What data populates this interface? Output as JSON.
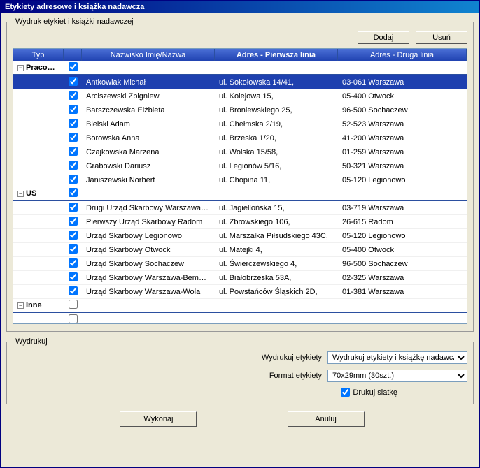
{
  "window": {
    "title": "Etykiety adresowe i książka nadawcza"
  },
  "group1": {
    "legend": "Wydruk etykiet i książki nadawczej"
  },
  "buttons": {
    "add": "Dodaj",
    "remove": "Usuń",
    "execute": "Wykonaj",
    "cancel": "Anuluj"
  },
  "columns": {
    "typ": "Typ",
    "name": "Nazwisko Imię/Nazwa",
    "adr1": "Adres - Pierwsza linia",
    "adr2": "Adres - Druga linia"
  },
  "groups": [
    {
      "label": "Pracownik",
      "checked": true,
      "rows": [
        {
          "checked": true,
          "selected": true,
          "name": "Antkowiak Michał",
          "adr1": "ul. Sokołowska 14/41,",
          "adr2": "03-061 Warszawa"
        },
        {
          "checked": true,
          "name": "Arciszewski Zbigniew",
          "adr1": "ul. Kolejowa 15,",
          "adr2": "05-400 Otwock"
        },
        {
          "checked": true,
          "name": "Barszczewska Elżbieta",
          "adr1": "ul. Broniewskiego 25,",
          "adr2": "96-500 Sochaczew"
        },
        {
          "checked": true,
          "name": "Bielski Adam",
          "adr1": "ul. Chełmska 2/19,",
          "adr2": "52-523 Warszawa"
        },
        {
          "checked": true,
          "name": "Borowska Anna",
          "adr1": "ul. Brzeska 1/20,",
          "adr2": "41-200 Warszawa"
        },
        {
          "checked": true,
          "name": "Czajkowska Marzena",
          "adr1": "ul. Wolska 15/58,",
          "adr2": "01-259 Warszawa"
        },
        {
          "checked": true,
          "name": "Grabowski Dariusz",
          "adr1": "ul. Legionów 5/16,",
          "adr2": "50-321 Warszawa"
        },
        {
          "checked": true,
          "name": "Janiszewski Norbert",
          "adr1": "ul. Chopina 11,",
          "adr2": "05-120 Legionowo"
        }
      ]
    },
    {
      "label": "US",
      "checked": true,
      "rows": [
        {
          "checked": true,
          "name": "Drugi Urząd Skarbowy Warszawa-Śró...",
          "adr1": "ul. Jagiellońska 15,",
          "adr2": "03-719 Warszawa"
        },
        {
          "checked": true,
          "name": "Pierwszy Urząd Skarbowy Radom",
          "adr1": "ul. Zbrowskiego 106,",
          "adr2": "26-615 Radom"
        },
        {
          "checked": true,
          "name": "Urząd Skarbowy Legionowo",
          "adr1": "ul. Marszałka Piłsudskiego 43C,",
          "adr2": "05-120 Legionowo"
        },
        {
          "checked": true,
          "name": "Urząd Skarbowy Otwock",
          "adr1": "ul. Matejki 4,",
          "adr2": "05-400 Otwock"
        },
        {
          "checked": true,
          "name": "Urząd Skarbowy Sochaczew",
          "adr1": "ul. Świerczewskiego 4,",
          "adr2": "96-500 Sochaczew"
        },
        {
          "checked": true,
          "name": "Urząd Skarbowy Warszawa-Bemowo",
          "adr1": "ul. Białobrzeska 53A,",
          "adr2": "02-325 Warszawa"
        },
        {
          "checked": true,
          "name": "Urząd Skarbowy Warszawa-Wola",
          "adr1": "ul. Powstańców Śląskich 2D,",
          "adr2": "01-381 Warszawa"
        }
      ]
    },
    {
      "label": "Inne",
      "checked": false,
      "rows": [
        {
          "checked": false,
          "name": "",
          "adr1": "",
          "adr2": ""
        }
      ]
    }
  ],
  "group2": {
    "legend": "Wydrukuj"
  },
  "form": {
    "print_label": "Wydrukuj etykiety",
    "print_value": "Wydrukuj etykiety i książkę nadawczą",
    "format_label": "Format etykiety",
    "format_value": "70x29mm (30szt.)",
    "grid_label": "Drukuj siatkę",
    "grid_checked": true
  }
}
